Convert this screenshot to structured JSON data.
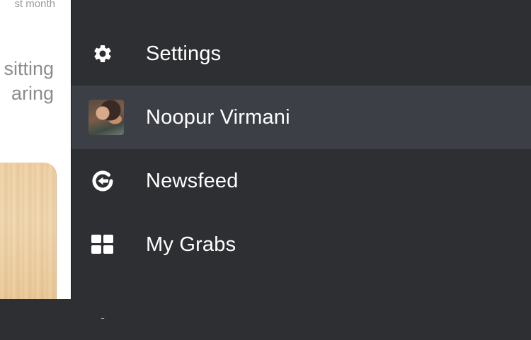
{
  "content_peek": {
    "meta_text": "st month",
    "line1": "sitting",
    "line2": "aring"
  },
  "menu": {
    "items": [
      {
        "label": "Settings",
        "icon": "gear-icon"
      },
      {
        "label": "Noopur Virmani",
        "icon": "avatar"
      },
      {
        "label": "Newsfeed",
        "icon": "newsfeed-g-icon"
      },
      {
        "label": "My Grabs",
        "icon": "grid-icon"
      }
    ]
  },
  "colors": {
    "menu_bg": "#2d2f33",
    "active_row_bg": "#3c3f46",
    "text": "#ffffff"
  }
}
